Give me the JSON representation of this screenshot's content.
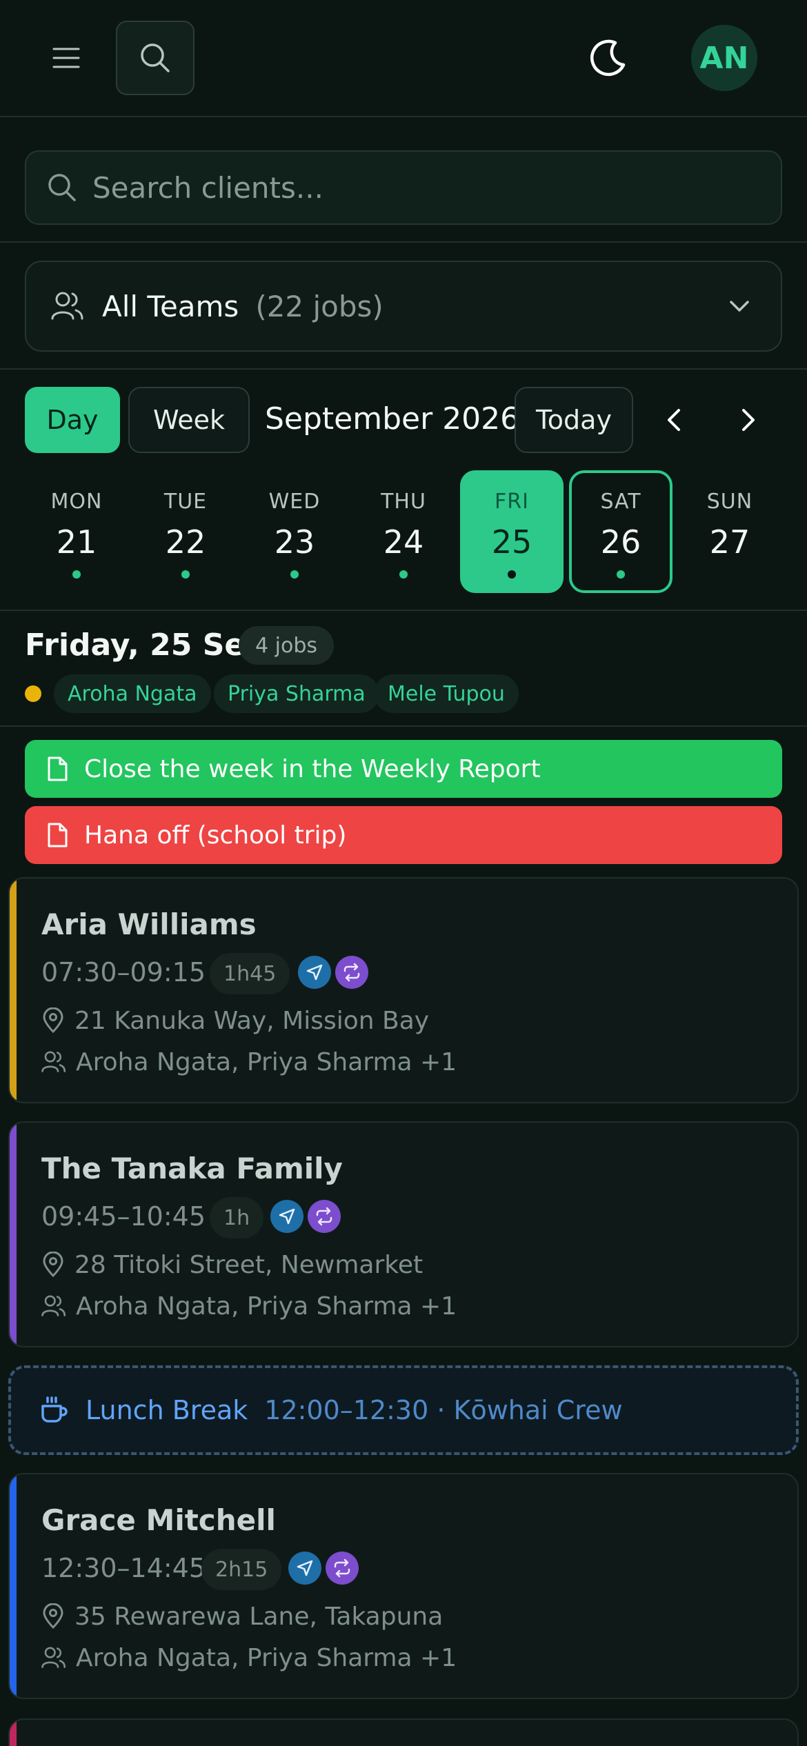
{
  "header": {
    "menu_icon": "menu-icon",
    "search_icon": "search-icon",
    "theme_icon": "moon-icon",
    "avatar_initials": "AN"
  },
  "search": {
    "placeholder": "Search clients..."
  },
  "team_filter": {
    "label": "All Teams",
    "count": "(22 jobs)"
  },
  "calendar": {
    "view_day": "Day",
    "view_week": "Week",
    "month": "September 2026",
    "today": "Today",
    "days": [
      {
        "name": "MON",
        "date": "21"
      },
      {
        "name": "TUE",
        "date": "22"
      },
      {
        "name": "WED",
        "date": "23"
      },
      {
        "name": "THU",
        "date": "24"
      },
      {
        "name": "FRI",
        "date": "25"
      },
      {
        "name": "SAT",
        "date": "26"
      },
      {
        "name": "SUN",
        "date": "27"
      }
    ]
  },
  "day_header": {
    "title": "Friday, 25 Sep",
    "jobs_badge": "4 jobs",
    "staff": [
      "Aroha Ngata",
      "Priya Sharma",
      "Mele Tupou"
    ]
  },
  "banners": [
    {
      "text": "Close the week in the Weekly Report",
      "color": "#22c55e"
    },
    {
      "text": "Hana off (school trip)",
      "color": "#ef4444"
    }
  ],
  "jobs": [
    {
      "client": "Aria Williams",
      "time": "07:30–09:15",
      "duration": "1h45",
      "address": "21 Kanuka Way, Mission Bay",
      "team": "Aroha Ngata, Priya Sharma +1",
      "accent": "#d4a017"
    },
    {
      "client": "The Tanaka Family",
      "time": "09:45–10:45",
      "duration": "1h",
      "address": "28 Titoki Street, Newmarket",
      "team": "Aroha Ngata, Priya Sharma +1",
      "accent": "#7c4dcc"
    },
    {
      "client": "Grace Mitchell",
      "time": "12:30–14:45",
      "duration": "2h15",
      "address": "35 Rewarewa Lane, Takapuna",
      "team": "Aroha Ngata, Priya Sharma +1",
      "accent": "#2563eb"
    }
  ],
  "lunch": {
    "title": "Lunch Break",
    "detail": "12:00–12:30 · Kōwhai Crew"
  },
  "colors": {
    "accent": "#2cc98b",
    "background": "#0b1613",
    "nav_badge": "#1e6fa8",
    "recurring_badge": "#7c4dcc"
  }
}
